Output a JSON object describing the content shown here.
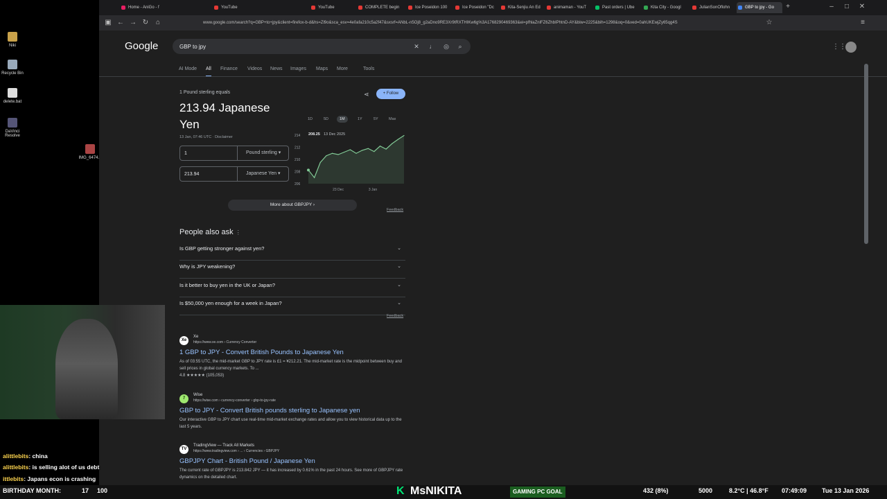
{
  "desktop": {
    "icons": [
      "Niki",
      "Recycle Bin",
      "delete.bat",
      "DaVinci Resolve",
      "IMG_6474..."
    ]
  },
  "browser": {
    "tabs": [
      "Home - AniGo - f",
      "YouTube",
      "YouTube",
      "COMPLETE begin",
      "Ice Poseidon 100",
      "Ice Poseidon \"Dc",
      "Kita-Senjiu An Ed",
      "animaman - YouT",
      "Past orders | Ube",
      "Kita City - Googl",
      "JulianSonOflohn",
      "GBP to jpy - Go"
    ],
    "active_tab": "GBP to jpy - Go",
    "url": "www.google.com/search?q=GBP+to+jpy&client=firefox-b-d&hs=Zl9o&sca_esv=4e0afa210c5a2f47&sxsrf=ANbL-n5Oj8_g2aDno9RE3Xr9tRXTHIKw6g%3A1768290469363&ei=pfhlaZnlFZ6ZhbIPhtnD-AY&biw=2225&bih=1298&oq=0&ved=0ahUKEwjZy65qg4S"
  },
  "google": {
    "logo": "Google",
    "query": "GBP to jpy",
    "nav_tabs": [
      "AI Mode",
      "All",
      "Finance",
      "Videos",
      "News",
      "Images",
      "Maps",
      "More",
      "Tools"
    ],
    "active_nav": "All"
  },
  "converter": {
    "subtitle": "1 Pound sterling equals",
    "result": "213.94 Japanese Yen",
    "timestamp": "13 Jan, 07:46 UTC · Disclaimer",
    "from_amount": "1",
    "from_currency": "Pound sterling",
    "to_amount": "213.94",
    "to_currency": "Japanese Yen",
    "follow_label": "Follow",
    "ranges": [
      "1D",
      "5D",
      "1M",
      "1Y",
      "5Y",
      "Max"
    ],
    "active_range": "1M",
    "more_label": "More about GBPJPY",
    "feedback": "Feedback"
  },
  "chart_data": {
    "type": "line",
    "x": [
      "13 Dec 2025",
      "15 Dec",
      "17 Dec",
      "19 Dec",
      "21 Dec",
      "23 Dec",
      "25 Dec",
      "27 Dec",
      "29 Dec",
      "31 Dec",
      "2 Jan",
      "4 Jan",
      "6 Jan",
      "8 Jan",
      "10 Jan",
      "12 Jan",
      "13 Jan"
    ],
    "values": [
      208.25,
      207.0,
      209.5,
      210.6,
      211.0,
      210.8,
      211.2,
      211.6,
      211.0,
      211.5,
      211.8,
      211.3,
      212.2,
      211.7,
      212.6,
      213.3,
      213.94
    ],
    "yticks": [
      206,
      208,
      210,
      212,
      214
    ],
    "xtick_labels": [
      "23 Dec",
      "3 Jan"
    ],
    "ylim": [
      206,
      214
    ],
    "tooltip_value": "208.25",
    "tooltip_date": "13 Dec 2025",
    "color": "#81c995"
  },
  "paa": {
    "title": "People also ask",
    "questions": [
      "Is GBP getting stronger against yen?",
      "Why is JPY weakening?",
      "Is it better to buy yen in the UK or Japan?",
      "Is $50,000 yen enough for a week in Japan?"
    ],
    "feedback": "Feedback"
  },
  "results": [
    {
      "source": "Xe",
      "cite": "https://www.xe.com › Currency Converter",
      "title": "1 GBP to JPY - Convert British Pounds to Japanese Yen",
      "snippet": "As of 03:55 UTC, the mid-market GBP to JPY rate is £1 = ¥212.21. The mid-market rate is the midpoint between buy and sell prices in global currency markets. To ...",
      "rating": "4.8 ★★★★★ (105,053)",
      "fav": "Xe",
      "fav_color": "#ffffff"
    },
    {
      "source": "Wise",
      "cite": "https://wise.com › currency-converter › gbp-to-jpy-rate",
      "title": "GBP to JPY - Convert British pounds sterling to Japanese yen",
      "snippet": "Our interactive GBP to JPY chart use real-time mid-market exchange rates and allow you to view historical data up to the last 5 years.",
      "rating": "",
      "fav": "7",
      "fav_color": "#9fe870"
    },
    {
      "source": "TradingView — Track All Markets",
      "cite": "https://www.tradingview.com › ... › Currencies › GBPJPY",
      "title": "GBPJPY Chart - British Pound / Japanese Yen",
      "snippet": "The current rate of GBPJPY is 213.842 JPY — it has increased by 0.61% in the past 24 hours. See more of GBPJPY rate dynamics on the detailed chart.",
      "rating": "",
      "fav": "TV",
      "fav_color": "#ffffff"
    }
  ],
  "chat": [
    {
      "user": "alittlebits",
      "text": ": china"
    },
    {
      "user": "alittlebits",
      "text": ": is selling alot of us debt"
    },
    {
      "user": "ittlebits",
      "text": ": Japans econ is crashing"
    }
  ],
  "bottombar": {
    "birthday": "BIRTHDAY MONTH:",
    "birthday_val": "17",
    "birthday_val2": "100",
    "streamer": "MsNIKITA",
    "goal_label": "GAMING PC GOAL",
    "goal_progress": "432 (8%)",
    "goal_target": "5000",
    "weather": "8.2°C | 46.8°F",
    "time": "07:49:09",
    "date": "Tue 13 Jan 2026"
  }
}
